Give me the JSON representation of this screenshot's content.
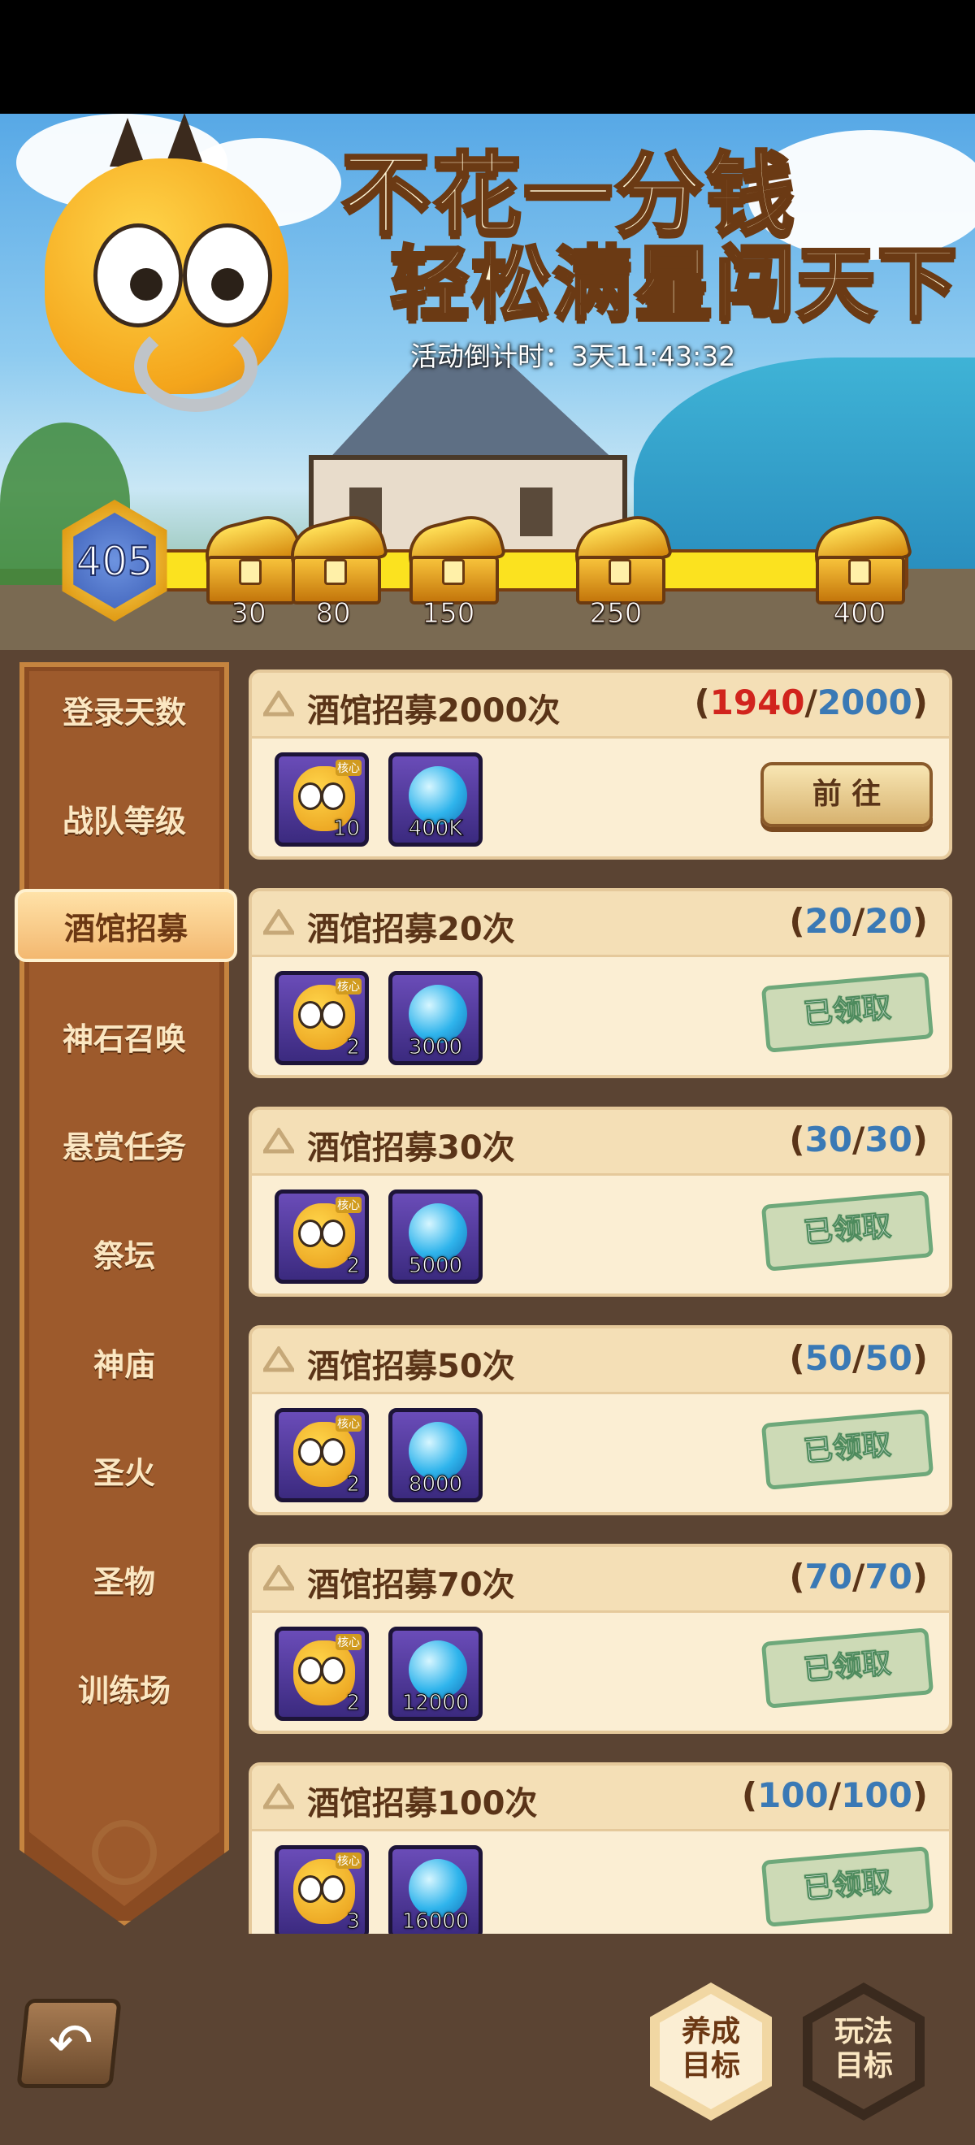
{
  "banner": {
    "title_line1": "不花一分钱",
    "title_line2": "轻松满星闯天下",
    "countdown": "活动倒计时：3天11:43:32"
  },
  "level": {
    "value": "405"
  },
  "milestones": [
    "30",
    "80",
    "150",
    "250",
    "400"
  ],
  "sidebar": {
    "items": [
      {
        "label": "登录天数"
      },
      {
        "label": "战队等级"
      },
      {
        "label": "酒馆招募",
        "active": true
      },
      {
        "label": "神石召唤"
      },
      {
        "label": "悬赏任务"
      },
      {
        "label": "祭坛"
      },
      {
        "label": "神庙"
      },
      {
        "label": "圣火"
      },
      {
        "label": "圣物"
      },
      {
        "label": "训练场"
      }
    ]
  },
  "tasks": [
    {
      "title": "酒馆招募2000次",
      "current": "1940",
      "target": "2000",
      "hero_qty": "10",
      "orb_qty": "400K",
      "action": "前 往",
      "status": "pending"
    },
    {
      "title": "酒馆招募20次",
      "current": "20",
      "target": "20",
      "hero_qty": "2",
      "orb_qty": "3000",
      "action": "已领取",
      "status": "claimed"
    },
    {
      "title": "酒馆招募30次",
      "current": "30",
      "target": "30",
      "hero_qty": "2",
      "orb_qty": "5000",
      "action": "已领取",
      "status": "claimed"
    },
    {
      "title": "酒馆招募50次",
      "current": "50",
      "target": "50",
      "hero_qty": "2",
      "orb_qty": "8000",
      "action": "已领取",
      "status": "claimed"
    },
    {
      "title": "酒馆招募70次",
      "current": "70",
      "target": "70",
      "hero_qty": "2",
      "orb_qty": "12000",
      "action": "已领取",
      "status": "claimed"
    },
    {
      "title": "酒馆招募100次",
      "current": "100",
      "target": "100",
      "hero_qty": "3",
      "orb_qty": "16000",
      "action": "已领取",
      "status": "claimed"
    }
  ],
  "reward_tag": "核心",
  "bottom": {
    "grow_goal_line1": "养成",
    "grow_goal_line2": "目标",
    "play_goal_line1": "玩法",
    "play_goal_line2": "目标"
  },
  "colors": {
    "progress_fill": "#fbe21f",
    "progress_current_incomplete": "#d1241d",
    "progress_complete": "#3a79b5",
    "claimed_stamp": "#6ea87a"
  }
}
